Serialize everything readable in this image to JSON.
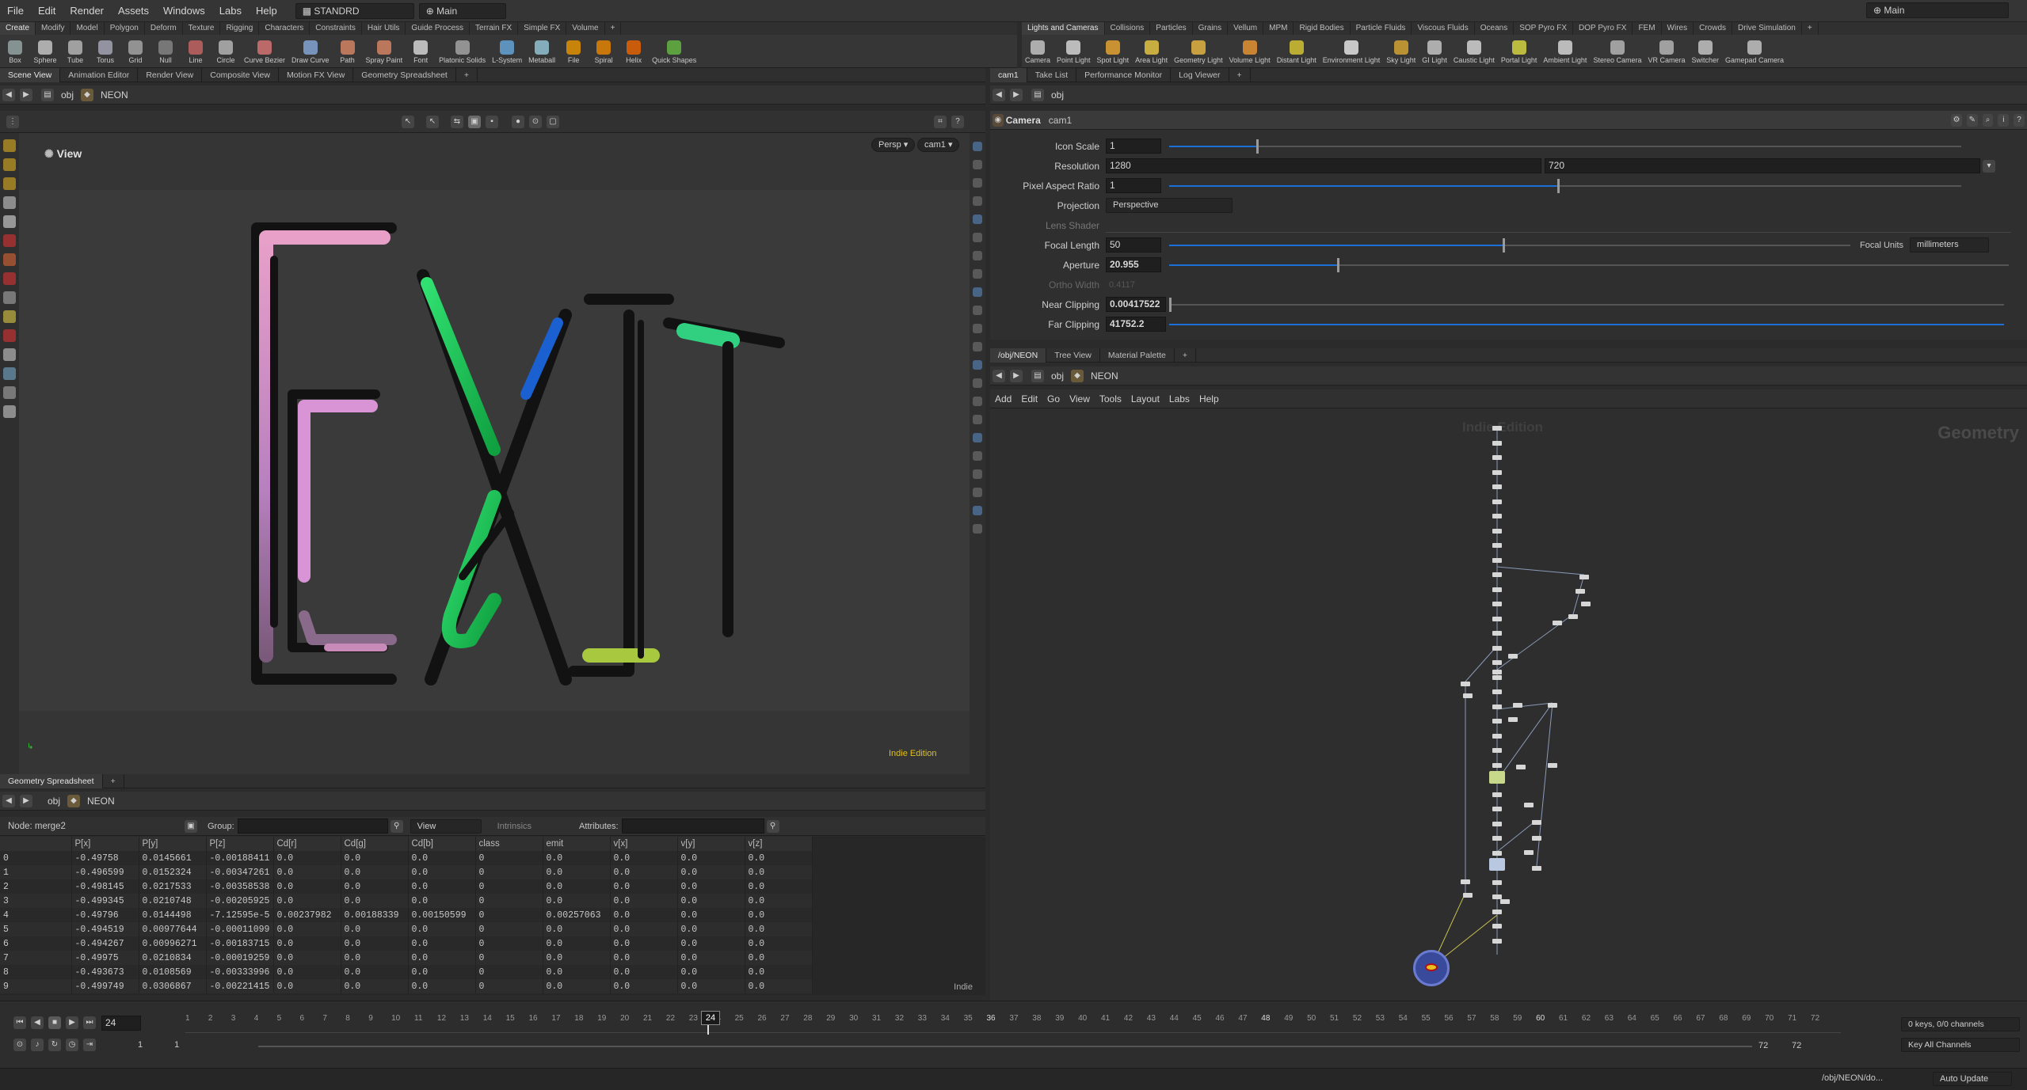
{
  "menubar": {
    "items": [
      "File",
      "Edit",
      "Render",
      "Assets",
      "Windows",
      "Labs",
      "Help"
    ],
    "desktop": "STANDRD",
    "context": "Main",
    "right_desktop": "Main"
  },
  "shelf_left": {
    "tabs": [
      "Create",
      "Modify",
      "Model",
      "Polygon",
      "Deform",
      "Texture",
      "Rigging",
      "Characters",
      "Constraints",
      "Hair Utils",
      "Guide Process",
      "Terrain FX",
      "Simple FX",
      "Volume"
    ],
    "tools": [
      "Box",
      "Sphere",
      "Tube",
      "Torus",
      "Grid",
      "Null",
      "Line",
      "Circle",
      "Curve Bezier",
      "Draw Curve",
      "Path",
      "Spray Paint",
      "Font",
      "Platonic Solids",
      "L-System",
      "Metaball",
      "File",
      "Spiral",
      "Helix",
      "Quick Shapes"
    ]
  },
  "shelf_right": {
    "tabs": [
      "Lights and Cameras",
      "Collisions",
      "Particles",
      "Grains",
      "Vellum",
      "MPM",
      "Rigid Bodies",
      "Particle Fluids",
      "Viscous Fluids",
      "Oceans",
      "SOP Pyro FX",
      "DOP Pyro FX",
      "FEM",
      "Wires",
      "Crowds",
      "Drive Simulation"
    ],
    "tools": [
      "Camera",
      "Point Light",
      "Spot Light",
      "Area Light",
      "Geometry Light",
      "Volume Light",
      "Distant Light",
      "Environment Light",
      "Sky Light",
      "GI Light",
      "Caustic Light",
      "Portal Light",
      "Ambient Light",
      "Stereo Camera",
      "VR Camera",
      "Switcher",
      "Gamepad Camera"
    ]
  },
  "scene_view": {
    "tabs": [
      "Scene View",
      "Animation Editor",
      "Render View",
      "Composite View",
      "Motion FX View",
      "Geometry Spreadsheet"
    ],
    "path": [
      "obj",
      "NEON"
    ],
    "view_label": "View",
    "persp": "Persp",
    "camera": "cam1",
    "edition": "Indie Edition",
    "neon_text": "EXIT"
  },
  "params": {
    "tabs": [
      "cam1",
      "Take List",
      "Performance Monitor",
      "Log Viewer"
    ],
    "path": [
      "obj"
    ],
    "type": "Camera",
    "name": "cam1",
    "icon_scale_label": "Icon Scale",
    "icon_scale": "1",
    "icon_scale_frac": 0.11,
    "resolution_label": "Resolution",
    "res_x": "1280",
    "res_y": "720",
    "pixel_aspect_label": "Pixel Aspect Ratio",
    "pixel_aspect": "1",
    "pixel_aspect_frac": 0.49,
    "projection_label": "Projection",
    "projection": "Perspective",
    "lens_shader_label": "Lens Shader",
    "focal_length_label": "Focal Length",
    "focal_length": "50",
    "focal_length_frac": 0.49,
    "focal_units_label": "Focal Units",
    "focal_units": "millimeters",
    "aperture_label": "Aperture",
    "aperture": "20.955",
    "aperture_frac": 0.2,
    "ortho_width_label": "Ortho Width",
    "ortho_width": "0.4117",
    "near_label": "Near Clipping",
    "near": "0.00417522",
    "far_label": "Far Clipping",
    "far": "41752.2"
  },
  "network": {
    "tabs": [
      "/obj/NEON",
      "Tree View",
      "Material Palette"
    ],
    "path": [
      "obj",
      "NEON"
    ],
    "menu": [
      "Add",
      "Edit",
      "Go",
      "View",
      "Tools",
      "Layout",
      "Labs",
      "Help"
    ],
    "watermark": "Indie Edition",
    "context_label": "Geometry"
  },
  "spreadsheet": {
    "tab": "Geometry Spreadsheet",
    "path": [
      "obj",
      "NEON"
    ],
    "node_label": "Node: merge2",
    "group_label": "Group:",
    "view_label": "View",
    "intrinsics_label": "Intrinsics",
    "attributes_label": "Attributes:",
    "columns": [
      "",
      "P[x]",
      "P[y]",
      "P[z]",
      "Cd[r]",
      "Cd[g]",
      "Cd[b]",
      "class",
      "emit",
      "v[x]",
      "v[y]",
      "v[z]"
    ],
    "rows": [
      [
        "0",
        "-0.49758",
        "0.0145661",
        "-0.00188411",
        "0.0",
        "0.0",
        "0.0",
        "0",
        "0.0",
        "0.0",
        "0.0",
        "0.0"
      ],
      [
        "1",
        "-0.496599",
        "0.0152324",
        "-0.00347261",
        "0.0",
        "0.0",
        "0.0",
        "0",
        "0.0",
        "0.0",
        "0.0",
        "0.0"
      ],
      [
        "2",
        "-0.498145",
        "0.0217533",
        "-0.00358538",
        "0.0",
        "0.0",
        "0.0",
        "0",
        "0.0",
        "0.0",
        "0.0",
        "0.0"
      ],
      [
        "3",
        "-0.499345",
        "0.0210748",
        "-0.00205925",
        "0.0",
        "0.0",
        "0.0",
        "0",
        "0.0",
        "0.0",
        "0.0",
        "0.0"
      ],
      [
        "4",
        "-0.49796",
        "0.0144498",
        "-7.12595e-5",
        "0.00237982",
        "0.00188339",
        "0.00150599",
        "0",
        "0.00257063",
        "0.0",
        "0.0",
        "0.0"
      ],
      [
        "5",
        "-0.494519",
        "0.00977644",
        "-0.00011099",
        "0.0",
        "0.0",
        "0.0",
        "0",
        "0.0",
        "0.0",
        "0.0",
        "0.0"
      ],
      [
        "6",
        "-0.494267",
        "0.00996271",
        "-0.00183715",
        "0.0",
        "0.0",
        "0.0",
        "0",
        "0.0",
        "0.0",
        "0.0",
        "0.0"
      ],
      [
        "7",
        "-0.49975",
        "0.0210834",
        "-0.00019259",
        "0.0",
        "0.0",
        "0.0",
        "0",
        "0.0",
        "0.0",
        "0.0",
        "0.0"
      ],
      [
        "8",
        "-0.493673",
        "0.0108569",
        "-0.00333996",
        "0.0",
        "0.0",
        "0.0",
        "0",
        "0.0",
        "0.0",
        "0.0",
        "0.0"
      ],
      [
        "9",
        "-0.499749",
        "0.0306867",
        "-0.00221415",
        "0.0",
        "0.0",
        "0.0",
        "0",
        "0.0",
        "0.0",
        "0.0",
        "0.0"
      ]
    ],
    "indie": "Indie"
  },
  "timeline": {
    "current_frame": "24",
    "ticks": [
      "1",
      "2",
      "3",
      "4",
      "5",
      "6",
      "7",
      "8",
      "9",
      "10",
      "11",
      "12",
      "13",
      "14",
      "15",
      "16",
      "17",
      "18",
      "19",
      "20",
      "21",
      "22",
      "23",
      "24",
      "25",
      "26",
      "27",
      "28",
      "29",
      "30",
      "31",
      "32",
      "33",
      "34",
      "35",
      "36",
      "37",
      "38",
      "39",
      "40",
      "41",
      "42",
      "43",
      "44",
      "45",
      "46",
      "47",
      "48",
      "49",
      "50",
      "51",
      "52",
      "53",
      "54",
      "55",
      "56",
      "57",
      "58",
      "59",
      "60",
      "61",
      "62",
      "63",
      "64",
      "65",
      "66",
      "67",
      "68",
      "69",
      "70",
      "71",
      "72"
    ],
    "start": "1",
    "start2": "1",
    "end": "72",
    "end2": "72",
    "keys_label": "0 keys, 0/0 channels",
    "key_all": "Key All Channels",
    "path_status": "/obj/NEON/do...",
    "auto_update": "Auto Update"
  }
}
